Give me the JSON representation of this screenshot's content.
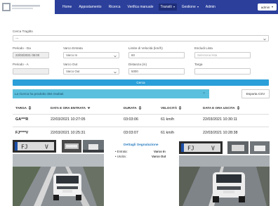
{
  "nav": {
    "links": [
      "Home",
      "Appostamento",
      "Ricerca",
      "Verifica manuale",
      "Transiti",
      "Gestione",
      "Admin"
    ],
    "active": "Transiti",
    "user": "admin"
  },
  "form": {
    "cerca_tragitto_label": "Cerca Tragitto",
    "cerca_tragitto_value": "---",
    "periodo_da_label": "Periodo - Da",
    "periodo_da_value": "22/03/2021 05:00",
    "periodo_a_label": "Periodo - A",
    "periodo_a_value": "",
    "varco_entrata_label": "Varco Entrata",
    "varco_entrata_value": "Varco In",
    "varco_out_label": "Varco Out",
    "varco_out_value": "Varco Out",
    "limite_label": "Limite di Velocità (km/h)",
    "limite_value": "60",
    "distanza_label": "Distanza (m)",
    "distanza_value": "5000",
    "escludi_label": "Escludi Lista",
    "escludi_placeholder": "Seleziona lista",
    "targa_label": "Targa",
    "targa_value": ""
  },
  "search_button": "Cerca",
  "alert": {
    "text": "La ricerca ha prodotto 384 risultati",
    "close": "×"
  },
  "export_button": "Esporta CSV",
  "table": {
    "headers": [
      "TARGA",
      "DATA E ORA ENTRATA",
      "DURATA",
      "VELOCITÀ",
      "DATA E ORA USCITA"
    ],
    "rows": [
      {
        "targa": "GA***R",
        "entrata": "22/03/2021 10:27:05",
        "durata": "03:03:06",
        "velocita": "61 km/h",
        "uscita": "22/03/2021 10:30:11"
      },
      {
        "targa": "FJ****V",
        "entrata": "22/03/2021 10:25:31",
        "durata": "03:03:07",
        "velocita": "61 km/h",
        "uscita": "22/03/2021 10:28:38"
      }
    ]
  },
  "details": {
    "title": "Dettagli Segnalazione",
    "entrata_label": "Entrata:",
    "entrata_value": "Varco In",
    "uscita_label": "Uscita:",
    "uscita_value": "Varco Out",
    "plate_left": "FJ",
    "plate_left_suffix": "V",
    "plate_right": "FJ",
    "plate_right_suffix": "V"
  },
  "colors": {
    "nav": "#2b3f9b",
    "primary": "#2b9fd9",
    "alert": "#5bc0de",
    "details_title": "#2b7fc1"
  }
}
